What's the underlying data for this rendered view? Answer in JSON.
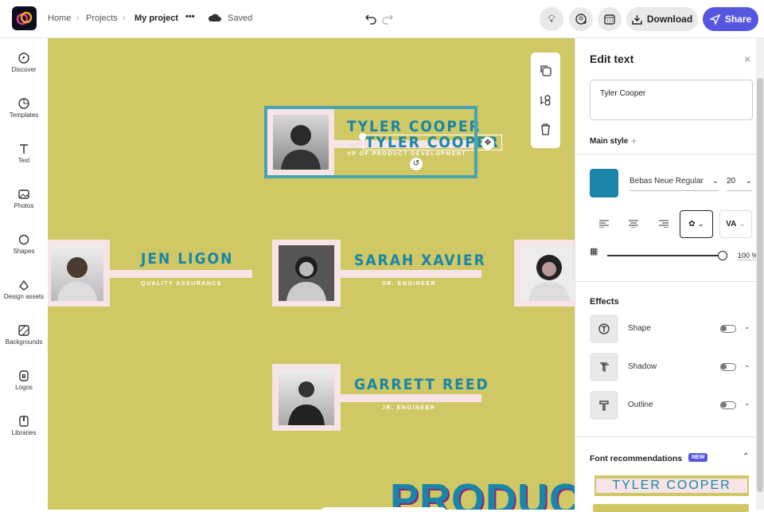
{
  "topbar": {
    "breadcrumb": [
      "Home",
      "Projects",
      "My project"
    ],
    "more": "•••",
    "status": "Saved",
    "download": "Download",
    "share": "Share"
  },
  "sidebar": [
    "Discover",
    "Templates",
    "Text",
    "Photos",
    "Shapes",
    "Design assets",
    "Backgrounds",
    "Logos",
    "Libraries"
  ],
  "canvas": {
    "selected": {
      "name": "TYLER COOPER",
      "name_edit": "TYLER COOPER",
      "title": "VP OF PRODUCT DEVELOPMENT"
    },
    "cards": [
      {
        "name": "JEN LIGON",
        "title": "QUALITY ASSURANCE"
      },
      {
        "name": "SARAH XAVIER",
        "title": "SR. ENGINEER"
      },
      {
        "name": "GARRETT REED",
        "title": "JR. ENGINEER"
      }
    ],
    "heading": "PRODUCT"
  },
  "panel": {
    "title": "Edit text",
    "text_value": "Tyler Cooper",
    "main_style": "Main style",
    "font": "Bebas Neue Regular",
    "size": "20",
    "opacity": "100 %",
    "opacity_value": 100,
    "color": "#1a85a8",
    "effects_title": "Effects",
    "effects": [
      "Shape",
      "Shadow",
      "Outline"
    ],
    "font_rec": "Font recommendations",
    "new_badge": "NEW",
    "rec_sample": "TYLER COOPER"
  }
}
